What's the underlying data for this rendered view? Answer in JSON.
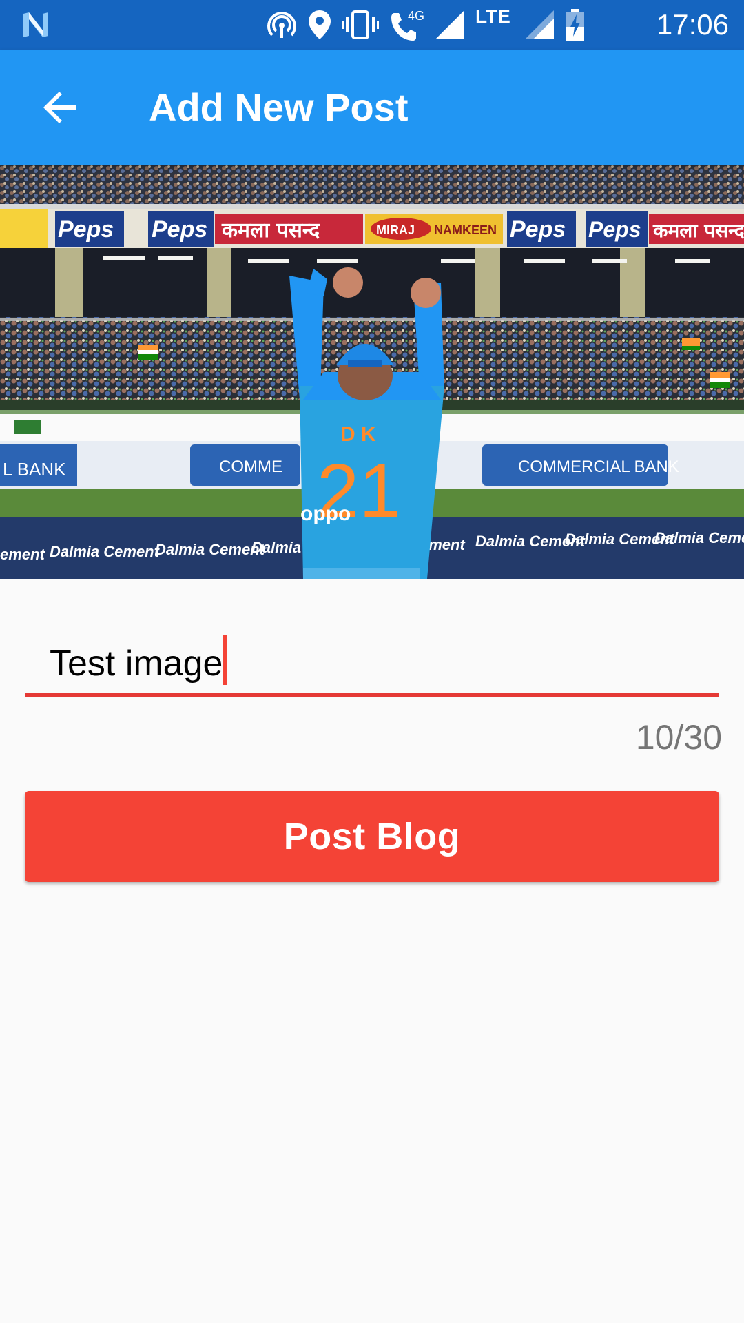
{
  "status_bar": {
    "time": "17:06",
    "network_badge": "4G",
    "lte_label": "LTE",
    "icons": [
      "n-logo-icon",
      "hotspot-icon",
      "location-icon",
      "vibrate-icon",
      "wifi-calling-icon",
      "signal-icon",
      "lte-signal-icon",
      "battery-charging-icon"
    ]
  },
  "app_bar": {
    "title": "Add New Post",
    "back_icon": "arrow-back-icon"
  },
  "hero_image": {
    "banners": {
      "peps": "Peps",
      "kamla": "कमला पसन्द",
      "miraj": "MIRAJ",
      "namkeen": "NAMKEEN",
      "commercial_bank": "COMMERCIAL BANK",
      "comme": "COMME",
      "al_bank": "L BANK",
      "dalmia": "Dalmia Cement",
      "ement": "ement",
      "jersey_name": "D K",
      "jersey_number": "21",
      "oppo": "oppo"
    }
  },
  "form": {
    "title_value": "Test image",
    "counter": "10/30",
    "submit_label": "Post Blog"
  },
  "colors": {
    "status_bar": "#1565c0",
    "app_bar": "#2196f3",
    "accent": "#f44336",
    "background": "#fafafa"
  }
}
